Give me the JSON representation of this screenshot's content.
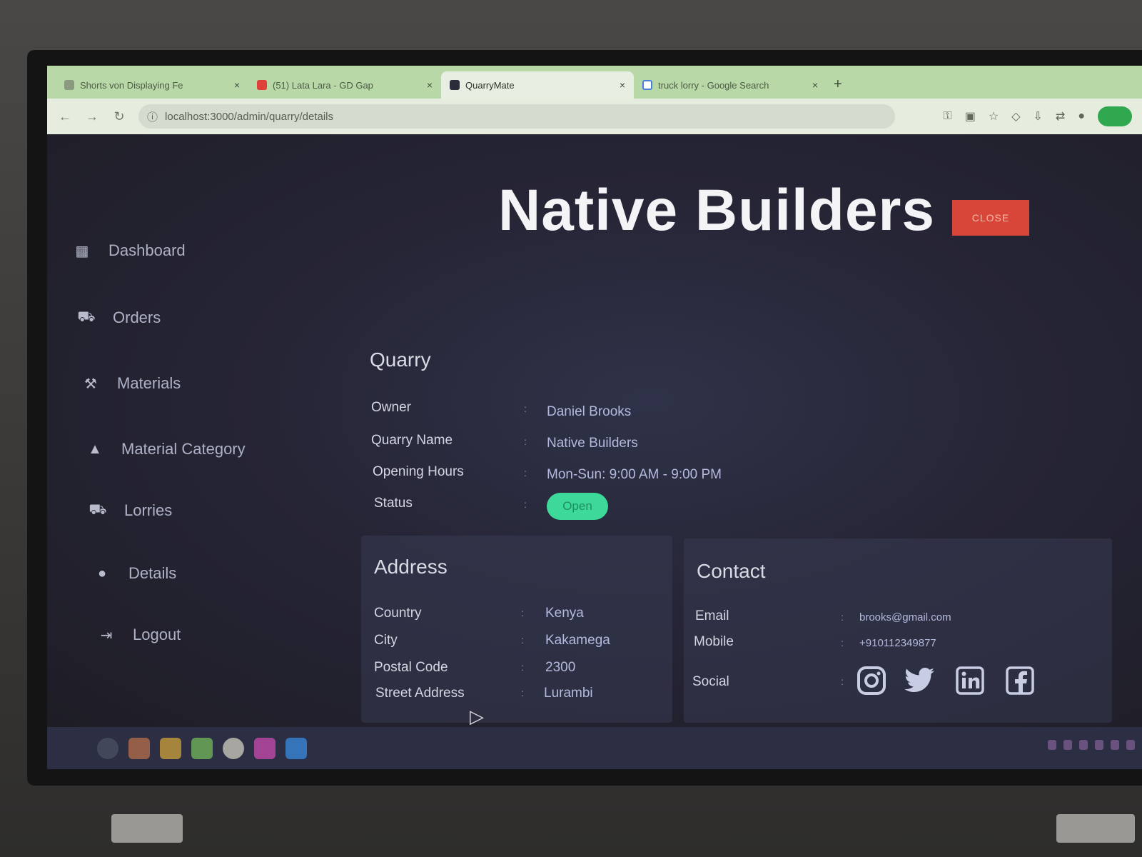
{
  "browser": {
    "tabs": [
      {
        "title": "Shorts von Displaying Fe",
        "close": "×"
      },
      {
        "title": "(51) Lata Lara - GD Gap",
        "close": "×"
      },
      {
        "title": "QuarryMate",
        "close": "×"
      },
      {
        "title": "truck lorry - Google Search",
        "close": "×"
      }
    ],
    "new_tab": "+",
    "url": "localhost:3000/admin/quarry/details"
  },
  "sidebar": {
    "items": [
      {
        "label": "Dashboard",
        "icon": "grid-icon"
      },
      {
        "label": "Orders",
        "icon": "truck-icon"
      },
      {
        "label": "Materials",
        "icon": "tools-icon"
      },
      {
        "label": "Material Category",
        "icon": "shapes-icon"
      },
      {
        "label": "Lorries",
        "icon": "lorry-icon"
      },
      {
        "label": "Details",
        "icon": "details-icon"
      },
      {
        "label": "Logout",
        "icon": "logout-icon"
      }
    ]
  },
  "header": {
    "title": "Native Builders",
    "close_label": "CLOSE"
  },
  "quarry": {
    "heading": "Quarry",
    "fields": [
      {
        "label": "Owner",
        "sep": ":",
        "value": "Daniel Brooks"
      },
      {
        "label": "Quarry Name",
        "sep": ":",
        "value": "Native Builders"
      },
      {
        "label": "Opening Hours",
        "sep": ":",
        "value": "Mon-Sun: 9:00 AM - 9:00 PM"
      },
      {
        "label": "Status",
        "sep": ":",
        "value": "Open"
      }
    ]
  },
  "address": {
    "heading": "Address",
    "fields": [
      {
        "label": "Country",
        "sep": ":",
        "value": "Kenya"
      },
      {
        "label": "City",
        "sep": ":",
        "value": "Kakamega"
      },
      {
        "label": "Postal Code",
        "sep": ":",
        "value": "2300"
      },
      {
        "label": "Street Address",
        "sep": ":",
        "value": "Lurambi"
      }
    ]
  },
  "contact": {
    "heading": "Contact",
    "fields": [
      {
        "label": "Email",
        "sep": ":",
        "value": "brooks@gmail.com"
      },
      {
        "label": "Mobile",
        "sep": ":",
        "value": "+910112349877"
      },
      {
        "label": "Social",
        "sep": ":"
      }
    ],
    "social_icons": [
      "instagram-icon",
      "twitter-icon",
      "linkedin-icon",
      "facebook-icon"
    ]
  },
  "colors": {
    "close_button": "#d8463a",
    "status_open": "#3dd99a",
    "app_background": "#262536"
  }
}
